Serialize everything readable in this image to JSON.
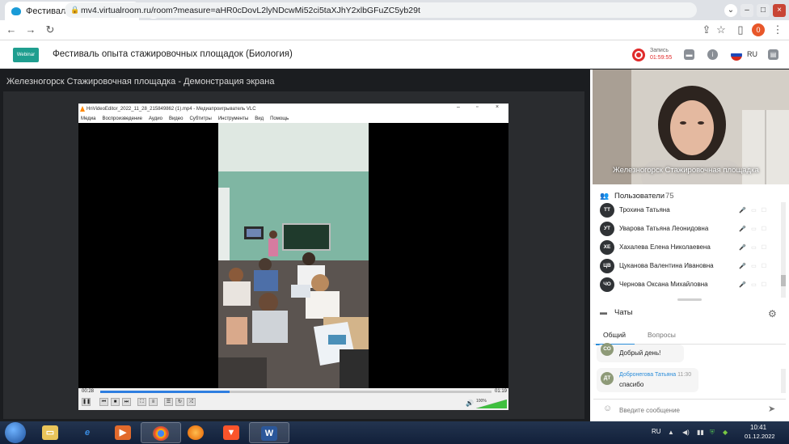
{
  "browser": {
    "tab_title": "Фестиваль опыта стажиров...",
    "tab_close": "×",
    "new_tab": "+",
    "url": "mv4.virtualroom.ru/room?measure=aHR0cDovL2lyNDcwMi52ci5taXJhY2xlbGFuZC5yb29t",
    "profile_initial": "0"
  },
  "app": {
    "logo_text": "Webinar",
    "event_title": "Фестиваль опыта стажировочных площадок (Биология)",
    "recording_label": "Запись",
    "recording_time": "01:59:55",
    "language": "RU"
  },
  "stage": {
    "title": "Железногорск Стажировочная площадка - Демонстрация экрана"
  },
  "vlc": {
    "title": "HnVideoEditor_2022_11_28_215849862 (1).mp4 - Медиапроигрыватель VLC",
    "menu": [
      "Медиа",
      "Воспроизведение",
      "Аудио",
      "Видео",
      "Субтитры",
      "Инструменты",
      "Вид",
      "Помощь"
    ],
    "time_current": "00:28",
    "time_total": "01:19",
    "progress": 0.33,
    "volume_label": "100%"
  },
  "webcam": {
    "label": "Железногорск Стажировочная площадка"
  },
  "users": {
    "header": "Пользователи",
    "count": "75",
    "items": [
      {
        "initials": "ТТ",
        "name": "Трохина Татьяна"
      },
      {
        "initials": "УТ",
        "name": "Уварова Татьяна Леонидовна"
      },
      {
        "initials": "ХЕ",
        "name": "Хахалева Елена Николаевена"
      },
      {
        "initials": "ЦВ",
        "name": "Цуканова Валентина Ивановна"
      },
      {
        "initials": "ЧО",
        "name": "Чернова Оксана Михайловна"
      }
    ]
  },
  "chats": {
    "header": "Чаты",
    "tabs": [
      "Общий",
      "Вопросы"
    ],
    "messages": [
      {
        "initials": "СО",
        "author": "",
        "time": "",
        "text": "Добрый день!"
      },
      {
        "initials": "ДТ",
        "author": "Добронегова Татьяна",
        "time": "11:30",
        "text": "спасибо"
      }
    ],
    "input_placeholder": "Введите сообщение"
  },
  "taskbar": {
    "lang": "RU",
    "time": "10:41",
    "date": "01.12.2022"
  },
  "colors": {
    "accent": "#2a8cd9",
    "record": "#e02b2b",
    "stage_bg": "#1b1d20"
  }
}
